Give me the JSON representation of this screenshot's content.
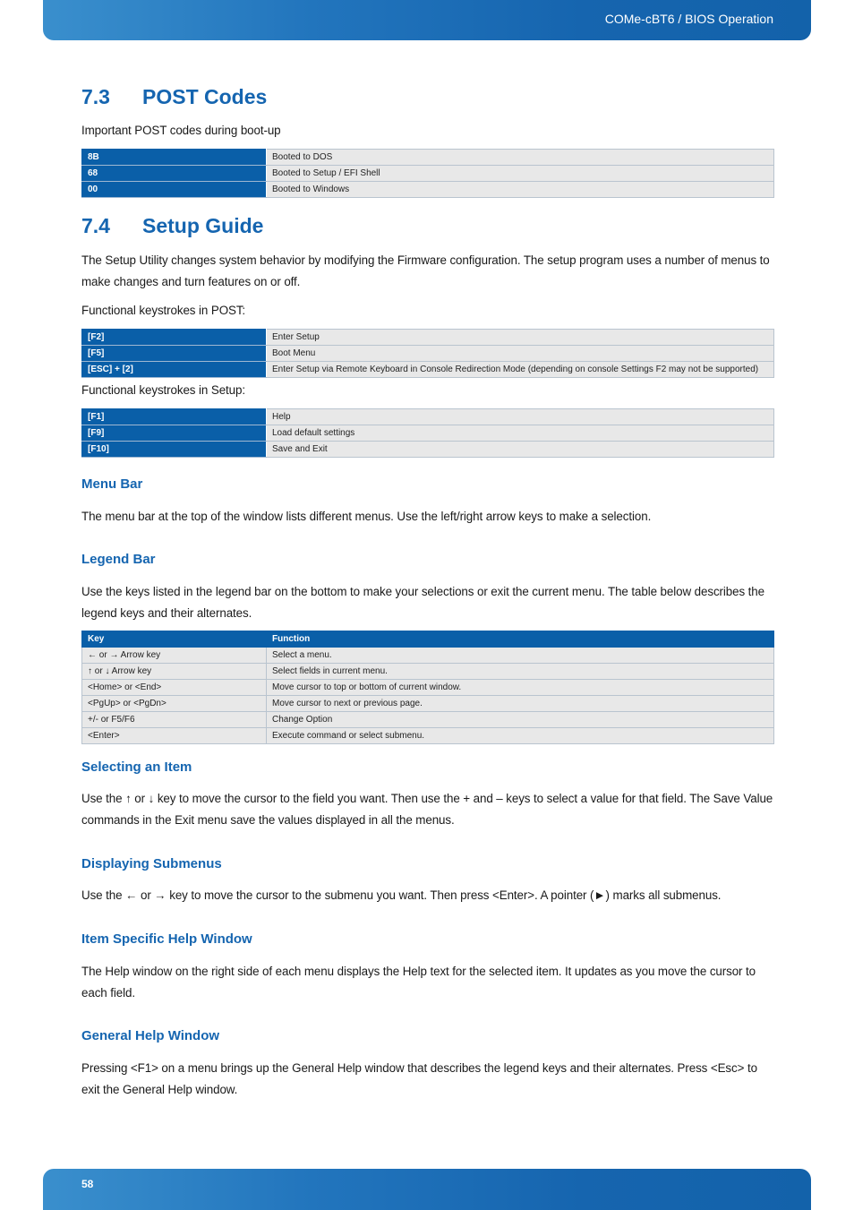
{
  "header": {
    "title": "COMe-cBT6 / BIOS Operation"
  },
  "footer": {
    "page_number": "58"
  },
  "section_7_3": {
    "number": "7.3",
    "title": "POST Codes",
    "intro": "Important POST codes during boot-up",
    "post_codes": [
      {
        "code": "8B",
        "description": "Booted to DOS"
      },
      {
        "code": "68",
        "description": "Booted to Setup / EFI Shell"
      },
      {
        "code": "00",
        "description": "Booted to Windows"
      }
    ]
  },
  "section_7_4": {
    "number": "7.4",
    "title": "Setup Guide",
    "intro": "The Setup Utility changes system behavior by modifying the Firmware configuration. The setup program uses a number of menus to make changes and turn features on or off.",
    "post_keystrokes_label": "Functional keystrokes in POST:",
    "post_keystrokes": [
      {
        "key": "[F2]",
        "description": "Enter Setup"
      },
      {
        "key": "[F5]",
        "description": "Boot Menu"
      },
      {
        "key": "[ESC] + [2]",
        "description": "Enter Setup via Remote Keyboard in Console Redirection Mode (depending on console Settings F2 may not be supported)"
      }
    ],
    "setup_keystrokes_label": "Functional keystrokes in Setup:",
    "setup_keystrokes": [
      {
        "key": "[F1]",
        "description": "Help"
      },
      {
        "key": "[F9]",
        "description": "Load default settings"
      },
      {
        "key": "[F10]",
        "description": "Save and Exit"
      }
    ],
    "menu_bar": {
      "heading": "Menu Bar",
      "text": "The menu bar at the top of the window lists different menus. Use the left/right arrow keys to make a selection."
    },
    "legend_bar": {
      "heading": "Legend Bar",
      "text": "Use the keys listed in the legend bar on the bottom to make your selections or exit the current menu. The table below describes the legend keys and their alternates.",
      "table": {
        "headers": [
          "Key",
          "Function"
        ],
        "rows": [
          [
            "← or → Arrow key",
            "Select a menu."
          ],
          [
            "↑ or ↓ Arrow key",
            "Select fields in current menu."
          ],
          [
            "<Home> or <End>",
            "Move cursor to top or bottom of current window."
          ],
          [
            "<PgUp> or <PgDn>",
            "Move cursor to next or previous page."
          ],
          [
            "+/- or F5/F6",
            "Change Option"
          ],
          [
            "<Enter>",
            "Execute command or select submenu."
          ]
        ]
      }
    },
    "selecting_item": {
      "heading": "Selecting an Item",
      "text": "Use the ↑ or ↓ key to move the cursor to the field you want. Then use the + and – keys to select a value for that field. The Save Value commands in the Exit menu save the values displayed in all the menus."
    },
    "displaying_submenus": {
      "heading": "Displaying Submenus",
      "text": "Use the ← or → key to move the cursor to the submenu you want. Then press <Enter>. A pointer (►) marks all submenus."
    },
    "item_help": {
      "heading": "Item Specific Help Window",
      "text": "The Help window on the right side of each menu displays the Help text for the selected item. It updates as you move the cursor to each field."
    },
    "general_help": {
      "heading": "General Help Window",
      "text": "Pressing <F1> on a menu brings up the General Help window that describes the legend keys and their alternates. Press <Esc> to exit the General Help window."
    }
  }
}
